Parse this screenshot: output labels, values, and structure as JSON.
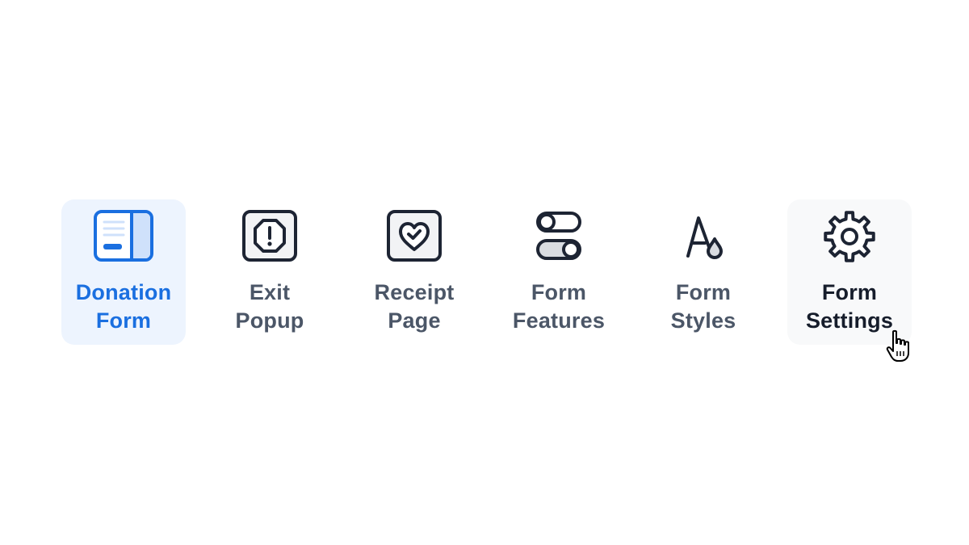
{
  "nav": {
    "tabs": [
      {
        "line1": "Donation",
        "line2": "Form",
        "icon": "donation-form-icon",
        "state": "selected"
      },
      {
        "line1": "Exit",
        "line2": "Popup",
        "icon": "exit-popup-icon",
        "state": "default"
      },
      {
        "line1": "Receipt",
        "line2": "Page",
        "icon": "receipt-page-icon",
        "state": "default"
      },
      {
        "line1": "Form",
        "line2": "Features",
        "icon": "form-features-icon",
        "state": "default"
      },
      {
        "line1": "Form",
        "line2": "Styles",
        "icon": "form-styles-icon",
        "state": "default"
      },
      {
        "line1": "Form",
        "line2": "Settings",
        "icon": "form-settings-icon",
        "state": "hover"
      }
    ]
  },
  "colors": {
    "active_text": "#1a6fe0",
    "active_bg": "#edf4fe",
    "default_text": "#4b5667",
    "hover_text": "#161d2b",
    "hover_bg": "#f8f9fa",
    "icon_stroke": "#1d2433"
  },
  "cursor": {
    "icon": "hand-pointer-icon"
  }
}
